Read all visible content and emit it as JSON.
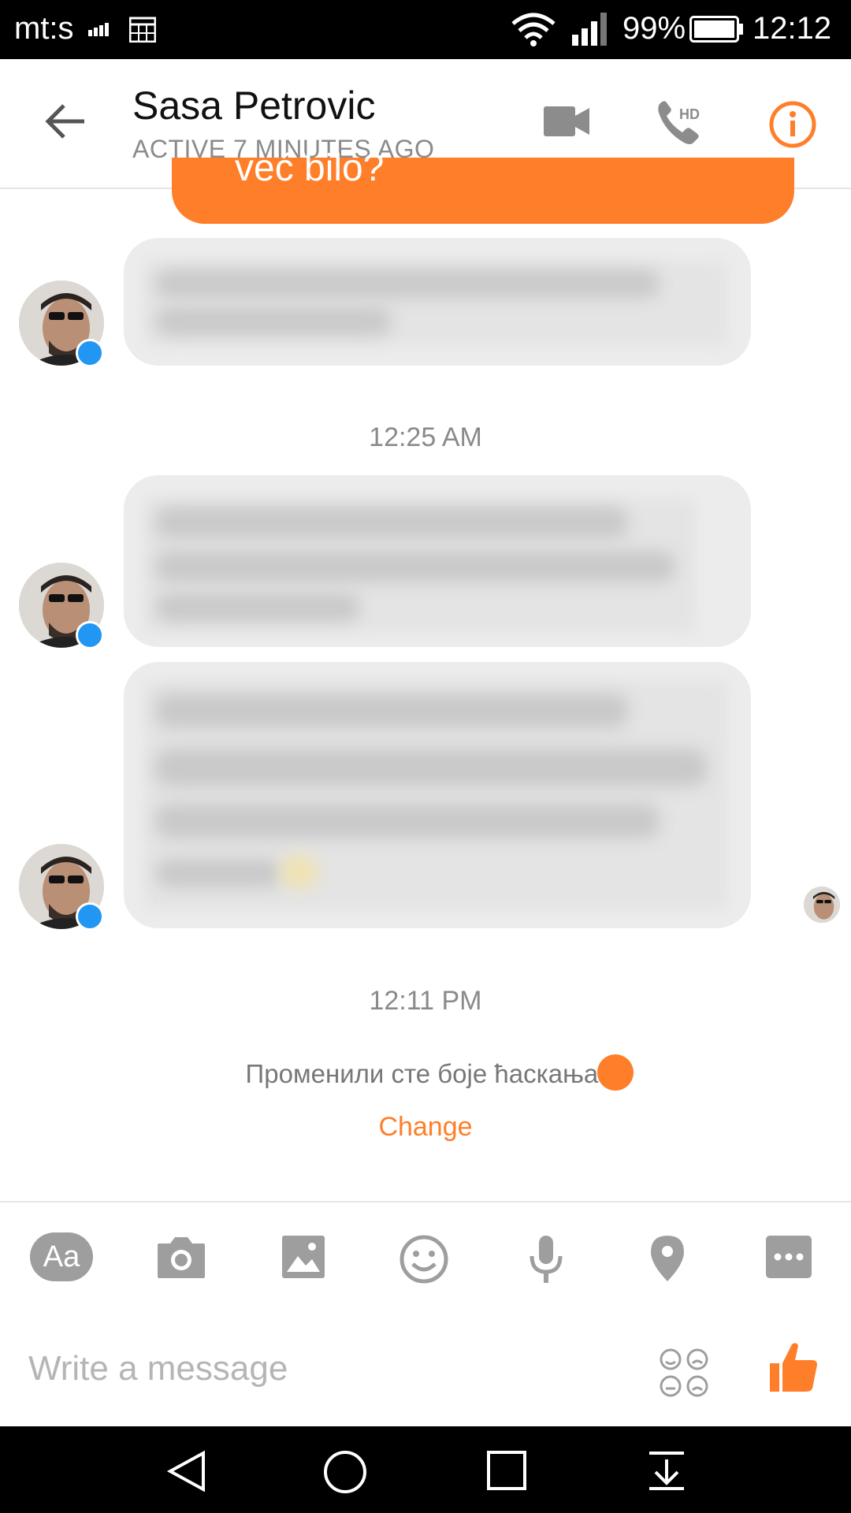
{
  "status_bar": {
    "carrier": "mt:s",
    "battery_percent": "99%",
    "time": "12:12"
  },
  "header": {
    "contact_name": "Sasa Petrovic",
    "presence": "ACTIVE 7 MINUTES AGO"
  },
  "thread": {
    "partial_sent_message": "već bilo?",
    "timestamps": [
      "12:25 AM",
      "12:11 PM"
    ],
    "color_change_notice": "Променили сте боје ћаскања.",
    "change_link": "Change"
  },
  "composer": {
    "placeholder": "Write a message",
    "text_button": "Aa"
  },
  "colors": {
    "accent": "#ff7e29",
    "bubble": "#ececec",
    "messenger_badge": "#2196f3"
  },
  "icons": {
    "header": [
      "back-arrow-icon",
      "video-call-icon",
      "hd-phone-icon",
      "info-icon"
    ],
    "toolbar": [
      "text-icon",
      "camera-icon",
      "gallery-icon",
      "emoji-icon",
      "microphone-icon",
      "location-pin-icon",
      "more-icon"
    ],
    "navigation": [
      "nav-back-icon",
      "nav-home-icon",
      "nav-recents-icon",
      "nav-notifications-icon"
    ]
  }
}
